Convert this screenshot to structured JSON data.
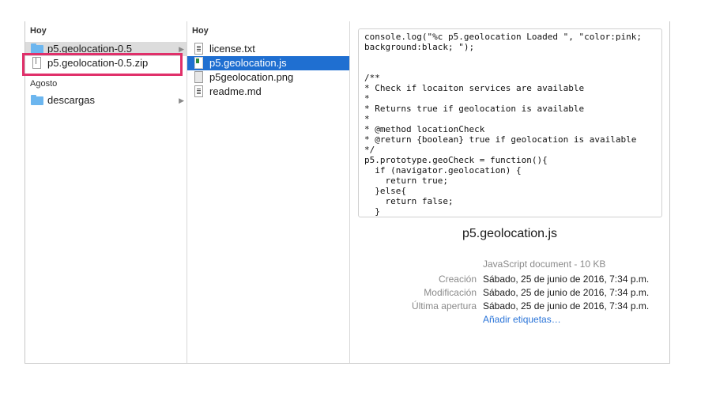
{
  "column1": {
    "section_today": "Hoy",
    "items_today": [
      {
        "label": "p5.geolocation-0.5",
        "icon": "folder-icon",
        "has_children": true,
        "selected": "inactive"
      },
      {
        "label": "p5.geolocation-0.5.zip",
        "icon": "zip-file-icon",
        "has_children": false,
        "selected": "none"
      }
    ],
    "section_august": "Agosto",
    "items_august": [
      {
        "label": "descargas",
        "icon": "folder-icon",
        "has_children": true
      }
    ],
    "chevron": "▶"
  },
  "column2": {
    "section_today": "Hoy",
    "items": [
      {
        "label": "license.txt",
        "icon": "text-file-icon"
      },
      {
        "label": "p5.geolocation.js",
        "icon": "js-file-icon",
        "selected": true
      },
      {
        "label": "p5geolocation.png",
        "icon": "image-file-icon"
      },
      {
        "label": "readme.md",
        "icon": "text-file-icon"
      }
    ]
  },
  "preview": {
    "code": "console.log(\"%c p5.geolocation Loaded \", \"color:pink;\nbackground:black; \");\n\n\n/**\n* Check if locaiton services are available\n*\n* Returns true if geolocation is available\n*\n* @method locationCheck\n* @return {boolean} true if geolocation is available\n*/\np5.prototype.geoCheck = function(){\n  if (navigator.geolocation) {\n    return true;\n  }else{\n    return false;\n  }",
    "file_name": "p5.geolocation.js",
    "kind": "JavaScript document - 10 KB",
    "created_label": "Creación",
    "created_value": "Sábado, 25 de junio de 2016, 7:34 p.m.",
    "modified_label": "Modificación",
    "modified_value": "Sábado, 25 de junio de 2016, 7:34 p.m.",
    "opened_label": "Última apertura",
    "opened_value": "Sábado, 25 de junio de 2016, 7:34 p.m.",
    "add_tags": "Añadir etiquetas…"
  },
  "colors": {
    "selection_blue": "#1f6fd1",
    "selection_gray": "#dcdcdc",
    "highlight_box": "#e0306a",
    "link": "#2a74d8"
  }
}
